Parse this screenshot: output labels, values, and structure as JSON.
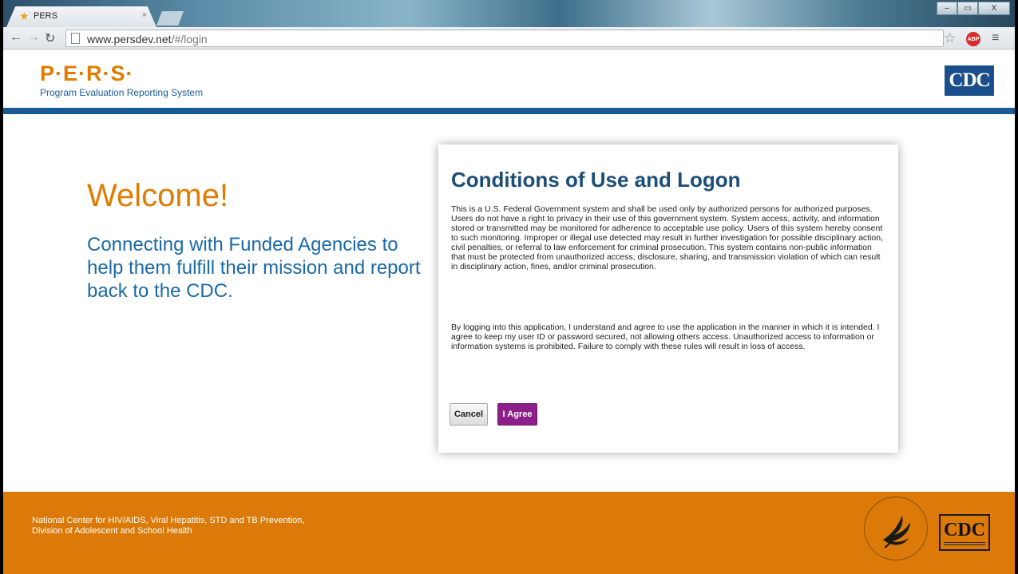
{
  "browser": {
    "tab_title": "PERS",
    "tab_close": "×",
    "url_host": "www.persdev.net",
    "url_path": "/#/login",
    "abp_label": "ABP",
    "window_buttons": {
      "minimize": "–",
      "maximize": "▭",
      "close": "X"
    },
    "icons": {
      "tab": "star-icon",
      "back": "back-arrow-icon",
      "forward": "forward-arrow-icon",
      "reload": "reload-icon",
      "page": "page-icon",
      "bookmark": "bookmark-star-icon",
      "menu": "hamburger-menu-icon"
    }
  },
  "header": {
    "logo": "P·E·R·S·",
    "subtitle": "Program Evaluation Reporting System",
    "cdc_logo": "CDC",
    "colors": {
      "orange": "#e07c00",
      "blue": "#1a5b96"
    }
  },
  "welcome": {
    "title": "Welcome!",
    "tagline": "Connecting with Funded Agencies to help them fulfill their mission and report back to the CDC."
  },
  "conditions": {
    "title": "Conditions of Use and Logon",
    "paragraph1": "This is a U.S. Federal Government system and shall be used only by authorized persons for authorized purposes. Users do not have a right to privacy in their use of this government system. System access, activity, and information stored or transmitted may be monitored for adherence to acceptable use policy. Users of this system hereby consent to such monitoring. Improper or illegal use detected may result in further investigation for possible disciplinary action, civil penalties, or referral to law enforcement for criminal prosecution. This system contains non-public information that must be protected from unauthorized access, disclosure, sharing, and transmission violation of which can result in disciplinary action, fines, and/or criminal prosecution.",
    "paragraph2": "By logging into this application, I understand and agree to use the application in the manner in which it is intended. I agree to keep my user ID or password secured, not allowing others access. Unauthorized access to information or information systems is prohibited. Failure to comply with these rules will result in loss of access.",
    "cancel_label": "Cancel",
    "agree_label": "I Agree",
    "colors": {
      "title": "#1b4e79",
      "agree_button": "#8d1f8a"
    }
  },
  "footer": {
    "line1": "National Center for HIV/AIDS, Viral Hepatitis, STD and TB Prevention,",
    "line2": "Division of Adolescent and School Health",
    "cdc_logo": "CDC",
    "seal_icon": "hhs-eagle-seal-icon",
    "color": "#db7a09"
  }
}
